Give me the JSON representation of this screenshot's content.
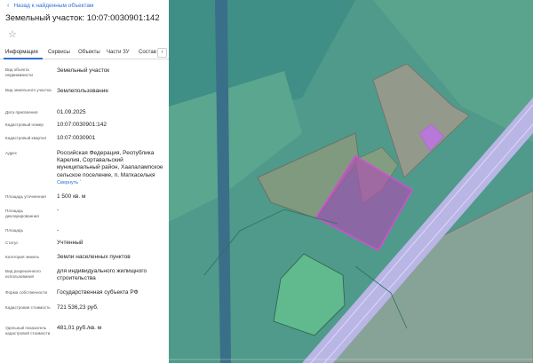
{
  "header": {
    "back_label": "Назад к найденным объектам",
    "title": "Земельный участок: 10:07:0030901:142"
  },
  "tabs": [
    {
      "label": "Информация",
      "active": true
    },
    {
      "label": "Сервисы",
      "active": false
    },
    {
      "label": "Объекты",
      "active": false
    },
    {
      "label": "Части ЗУ",
      "active": false
    },
    {
      "label": "Состав",
      "active": false
    }
  ],
  "info": {
    "object_type": {
      "label": "Вид объекта недвижимости",
      "value": "Земельный участок"
    },
    "plot_type": {
      "label": "Вид земельного участка",
      "value": "Землепользование"
    },
    "assigned_date": {
      "label": "Дата присвоения",
      "value": "01.09.2025"
    },
    "cadastral_number": {
      "label": "Кадастровый номер",
      "value": "10:07:0030901:142"
    },
    "cadastral_block": {
      "label": "Кадастровый квартал",
      "value": "10:07:0030901"
    },
    "address": {
      "label": "Адрес",
      "value": "Российская Федерация, Республика Карелия, Сортавальский муниципальный район, Хаапалампское сельское поселение, п. Маткаселькя",
      "link": "Свернуть"
    },
    "area_specified": {
      "label": "Площадь уточненная",
      "value": "1 500 кв. м"
    },
    "area_declared": {
      "label": "Площадь декларированная",
      "value": "-"
    },
    "area": {
      "label": "Площадь",
      "value": "-"
    },
    "status": {
      "label": "Статус",
      "value": "Учтенный"
    },
    "land_category": {
      "label": "Категория земель",
      "value": "Земли населенных пунктов"
    },
    "permitted_use": {
      "label": "Вид разрешенного использования",
      "value": "для индивидуального жилищного строительства"
    },
    "ownership": {
      "label": "Форма собственности",
      "value": "Государственная субъекта РФ"
    },
    "cadastral_value": {
      "label": "Кадастровая стоимость",
      "value": "721 536,23 руб."
    },
    "specific_value": {
      "label": "Удельный показатель кадастровой стоимости",
      "value": "481,01 руб./кв. м"
    }
  },
  "icons": {
    "back": "chevron-left-icon",
    "favorite": "star-outline-icon",
    "tabs_next": "chevron-right-icon"
  },
  "colors": {
    "link": "#2f6fd6",
    "map_teal": "#4f9a8a",
    "map_green": "#5fb685",
    "road_lavender": "#b9b6e6",
    "selected_parcel": "#b04ab4"
  }
}
